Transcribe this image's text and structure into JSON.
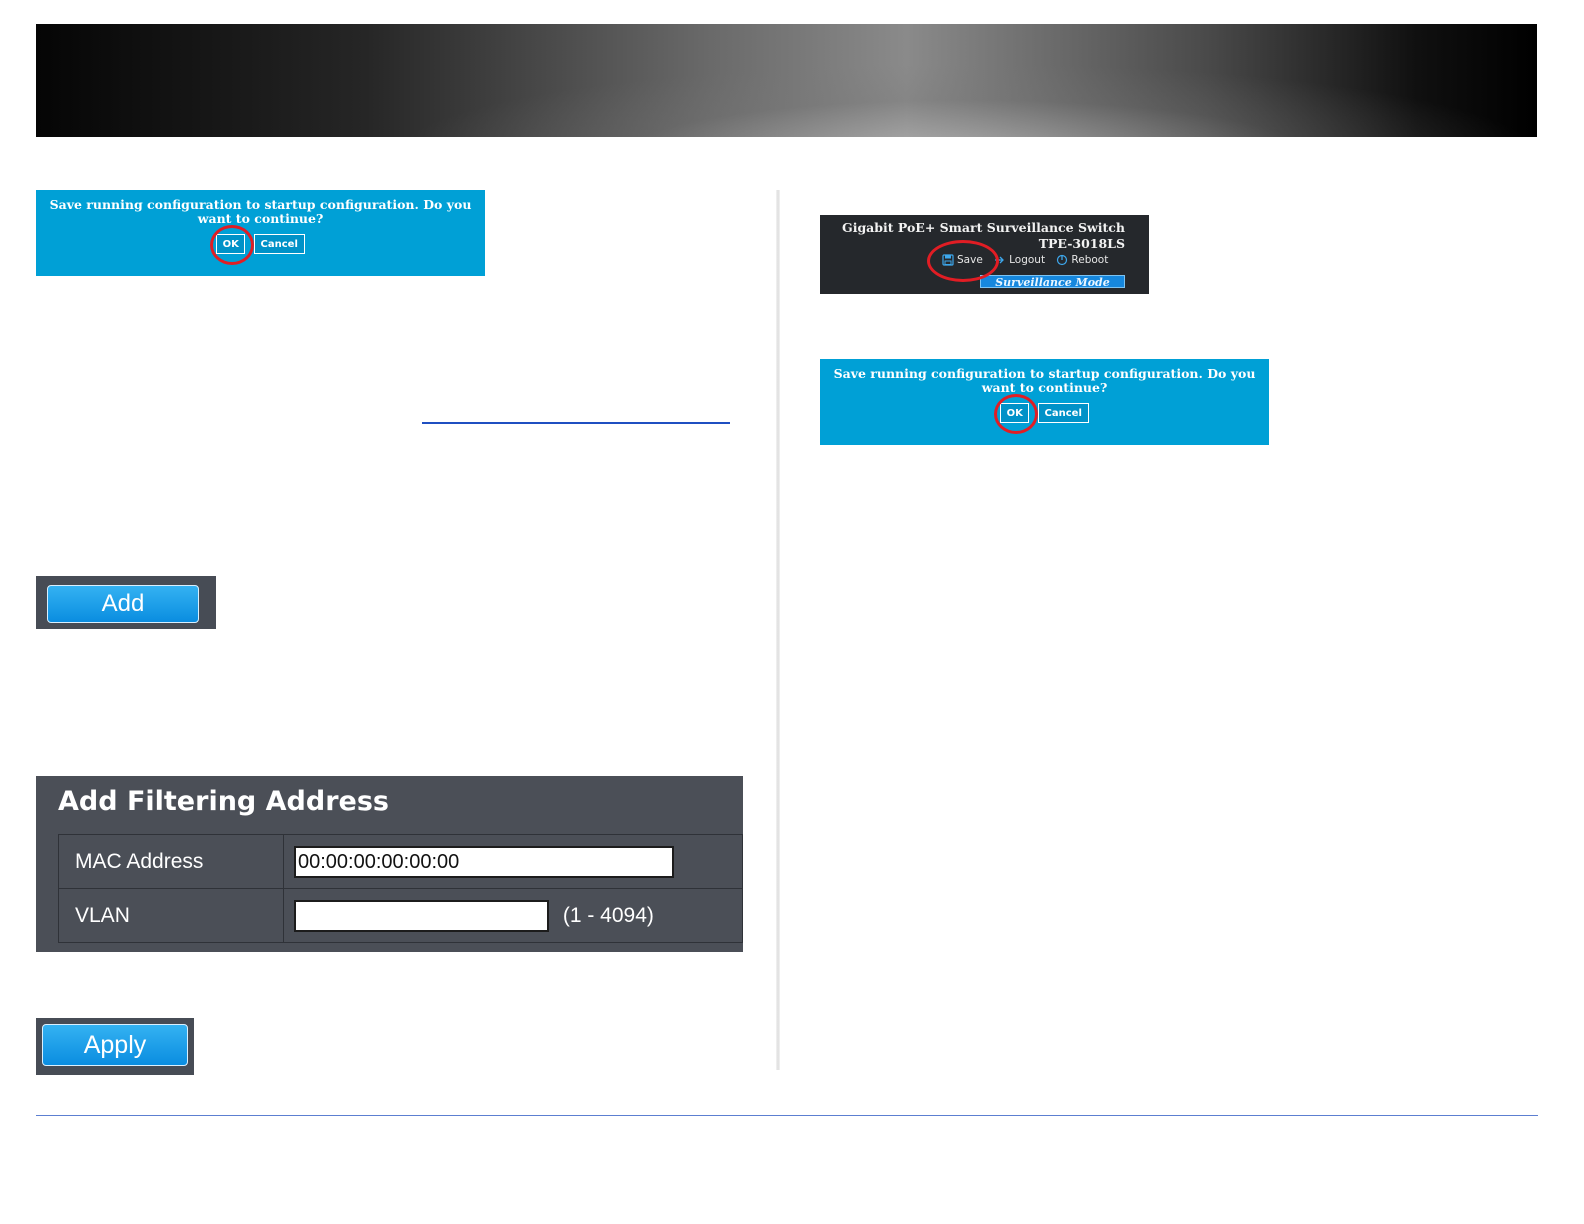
{
  "save_dialog": {
    "message": "Save running configuration to startup configuration. Do you want to continue?",
    "ok_label": "OK",
    "cancel_label": "Cancel"
  },
  "switch_header": {
    "product_name": "Gigabit PoE+ Smart Surveillance Switch",
    "model": "TPE-3018LS",
    "save_label": "Save",
    "logout_label": "Logout",
    "reboot_label": "Reboot",
    "mode_label": "Surveillance Mode",
    "icons": [
      "save-icon",
      "logout-icon",
      "reboot-icon"
    ]
  },
  "add_button_label": "Add",
  "filter_form": {
    "title": "Add Filtering Address",
    "mac_label": "MAC Address",
    "mac_value": "00:00:00:00:00:00",
    "vlan_label": "VLAN",
    "vlan_value": "",
    "vlan_range": "(1 - 4094)"
  },
  "apply_button_label": "Apply",
  "colors": {
    "dialog_blue": "#00a0d6",
    "highlight_red": "#e11d24",
    "panel_gray": "#4b4f57",
    "button_blue": "#0a8de0"
  }
}
